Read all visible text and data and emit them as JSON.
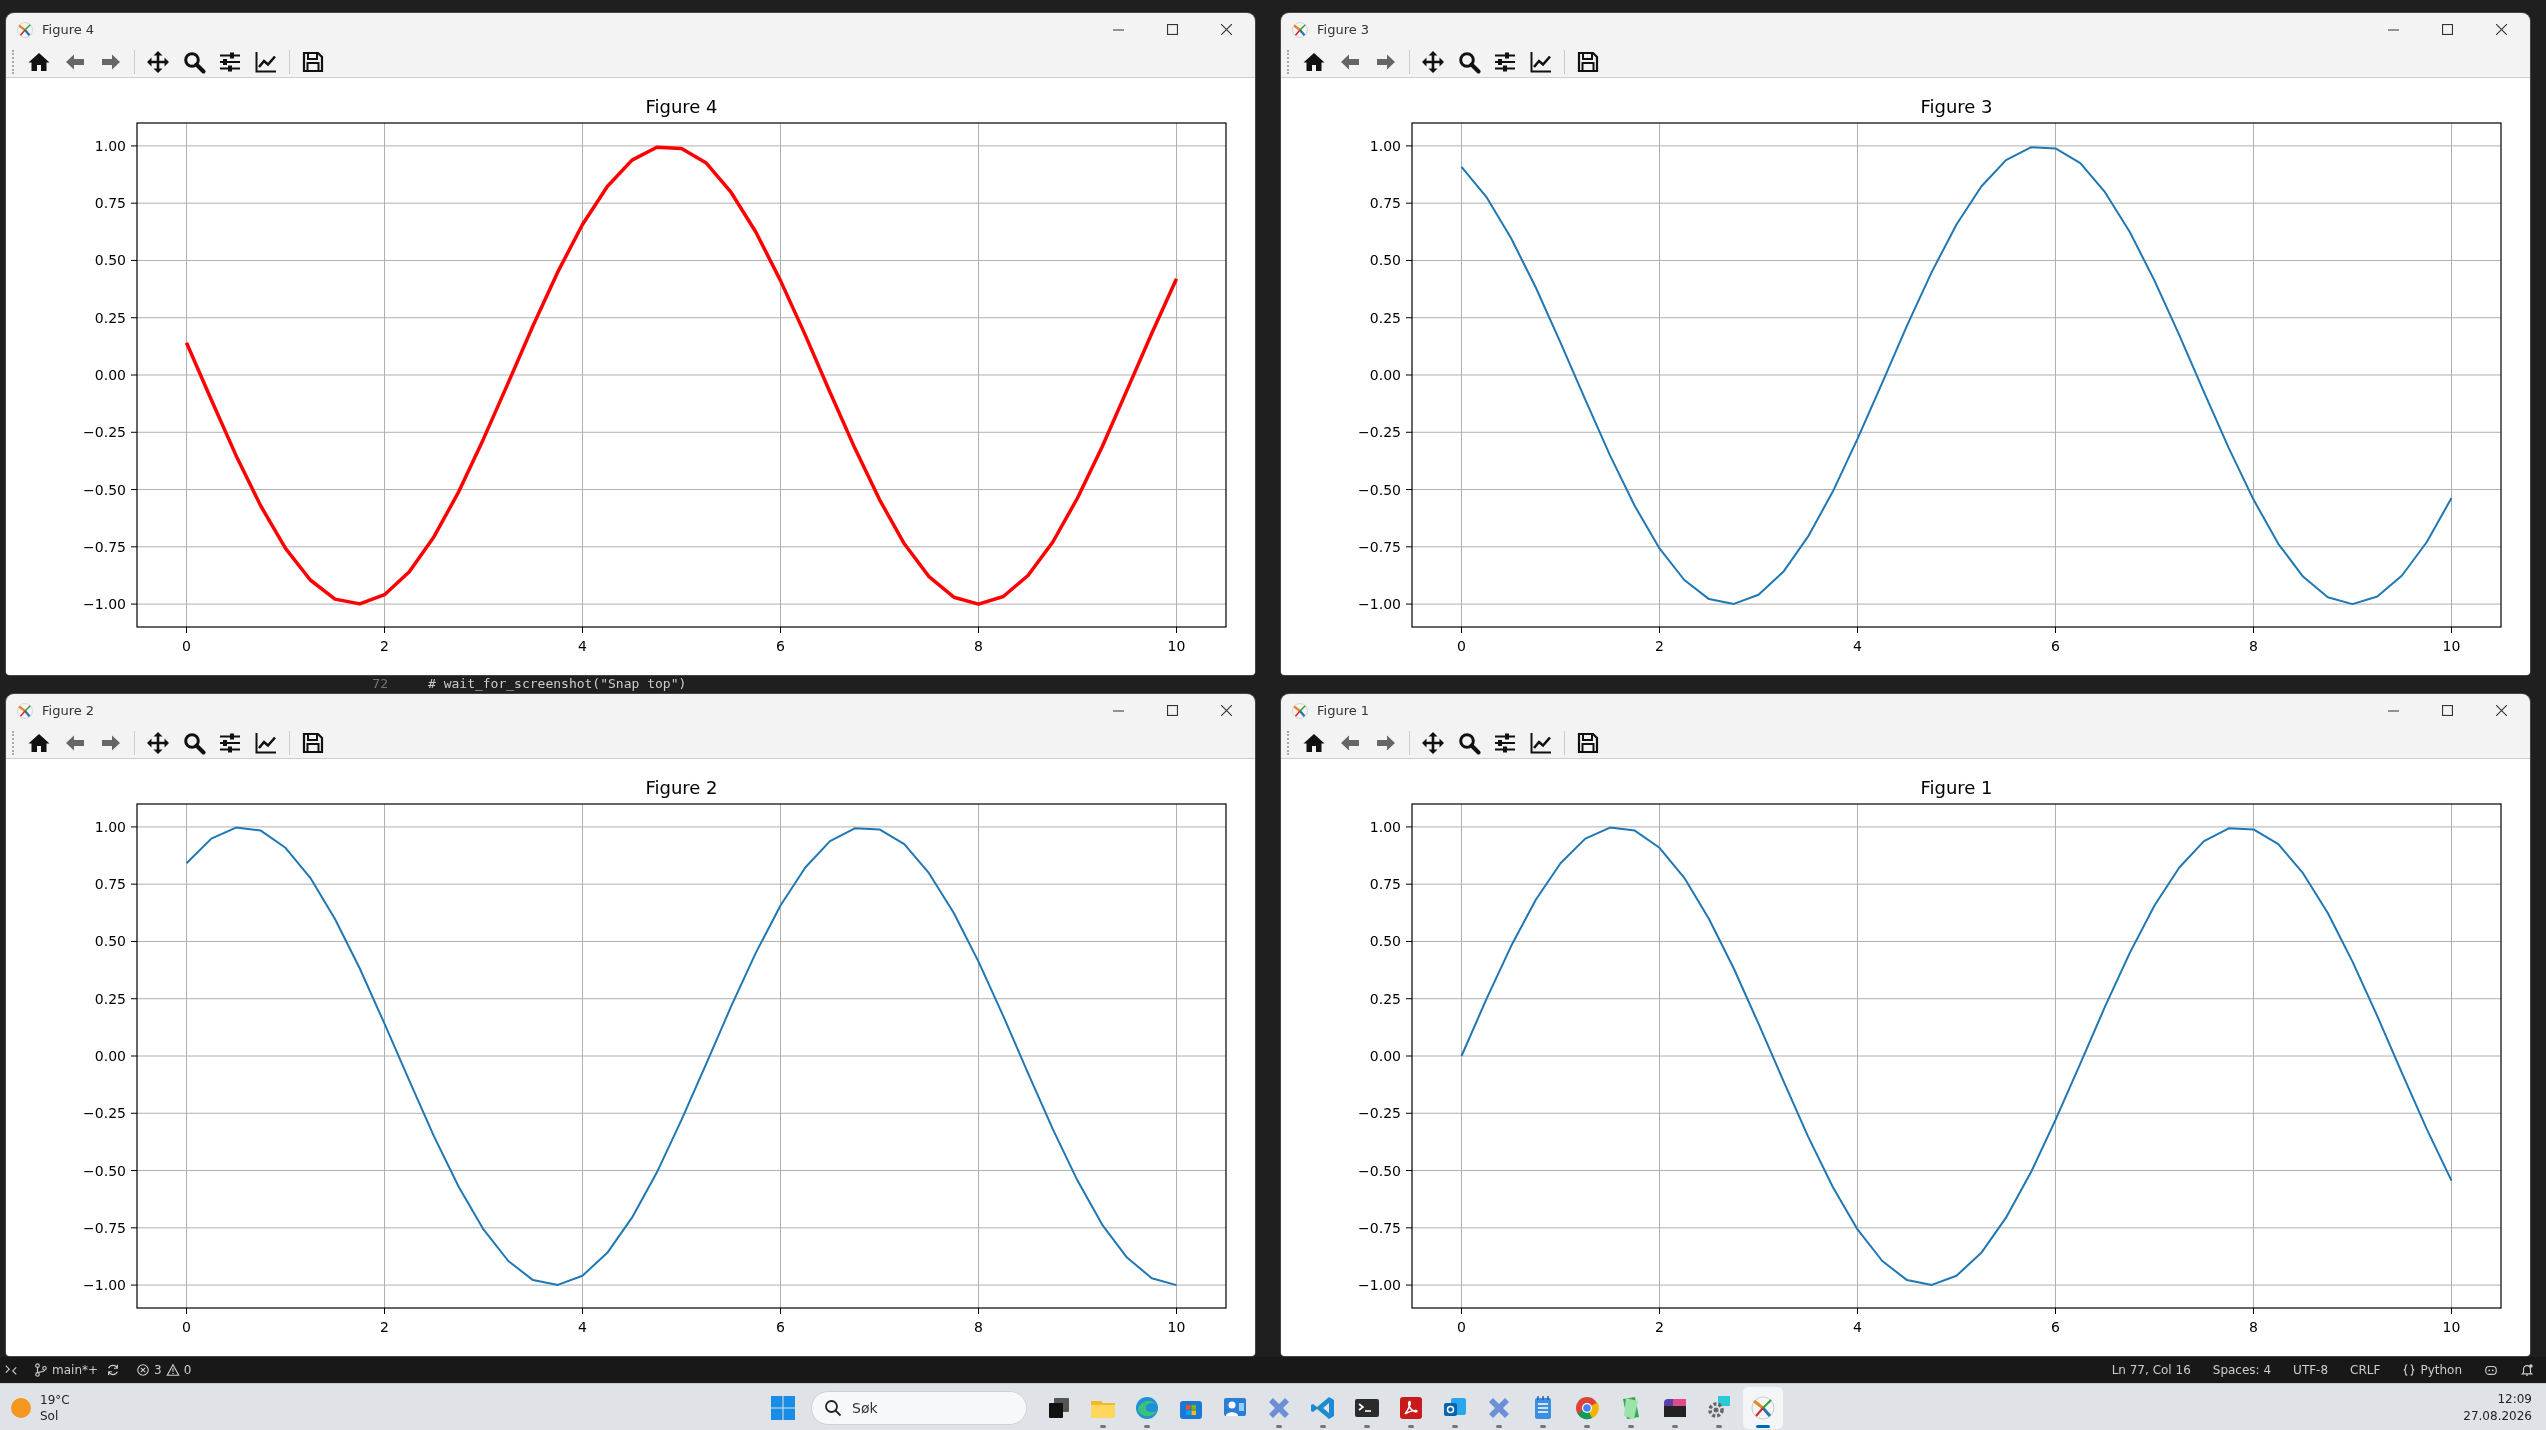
{
  "editor": {
    "line_number": "72",
    "code": "# wait_for_screenshot(\"Snap top\")"
  },
  "windows": [
    {
      "title": "Figure 4",
      "chart_data": {
        "type": "line",
        "title": "Figure 4",
        "grid": true,
        "x": [
          0,
          0.25,
          0.5,
          0.75,
          1,
          1.25,
          1.5,
          1.75,
          2,
          2.25,
          2.5,
          2.75,
          3,
          3.25,
          3.5,
          3.75,
          4,
          4.25,
          4.5,
          4.75,
          5,
          5.25,
          5.5,
          5.75,
          6,
          6.25,
          6.5,
          6.75,
          7,
          7.25,
          7.5,
          7.75,
          8,
          8.25,
          8.5,
          8.75,
          9,
          9.25,
          9.5,
          9.75,
          10
        ],
        "series": [
          {
            "color": "#ff0000",
            "values": [
              0.141,
              -0.108,
              -0.351,
              -0.572,
              -0.757,
              -0.895,
              -0.978,
              -0.999,
              -0.959,
              -0.859,
              -0.706,
              -0.509,
              -0.279,
              -0.033,
              0.215,
              0.45,
              0.657,
              0.823,
              0.938,
              0.994,
              0.989,
              0.925,
              0.798,
              0.624,
              0.412,
              0.174,
              -0.075,
              -0.319,
              -0.544,
              -0.737,
              -0.88,
              -0.97,
              -1,
              -0.967,
              -0.875,
              -0.729,
              -0.537,
              -0.312,
              -0.066,
              0.182,
              0.42
            ]
          }
        ],
        "xlim": [
          -0.5,
          10.5
        ],
        "ylim": [
          -1.1,
          1.1
        ],
        "xticks": [
          0,
          2,
          4,
          6,
          8,
          10
        ],
        "yticks": [
          {
            "value": -1,
            "label": "−1.00"
          },
          {
            "value": -0.75,
            "label": "−0.75"
          },
          {
            "value": -0.5,
            "label": "−0.50"
          },
          {
            "value": -0.25,
            "label": "−0.25"
          },
          {
            "value": 0,
            "label": "0.00"
          },
          {
            "value": 0.25,
            "label": "0.25"
          },
          {
            "value": 0.5,
            "label": "0.50"
          },
          {
            "value": 0.75,
            "label": "0.75"
          },
          {
            "value": 1,
            "label": "1.00"
          }
        ]
      }
    },
    {
      "title": "Figure 3",
      "chart_data": {
        "type": "line",
        "title": "Figure 3",
        "grid": true,
        "x": [
          0,
          0.25,
          0.5,
          0.75,
          1,
          1.25,
          1.5,
          1.75,
          2,
          2.25,
          2.5,
          2.75,
          3,
          3.25,
          3.5,
          3.75,
          4,
          4.25,
          4.5,
          4.75,
          5,
          5.25,
          5.5,
          5.75,
          6,
          6.25,
          6.5,
          6.75,
          7,
          7.25,
          7.5,
          7.75,
          8,
          8.25,
          8.5,
          8.75,
          9,
          9.25,
          9.5,
          9.75,
          10
        ],
        "series": [
          {
            "color": "#1f77b4",
            "values": [
              0.909,
              0.778,
              0.598,
              0.382,
              0.141,
              -0.108,
              -0.351,
              -0.572,
              -0.757,
              -0.895,
              -0.978,
              -0.999,
              -0.959,
              -0.859,
              -0.706,
              -0.509,
              -0.279,
              -0.033,
              0.215,
              0.45,
              0.657,
              0.823,
              0.938,
              0.994,
              0.989,
              0.925,
              0.798,
              0.624,
              0.412,
              0.174,
              -0.075,
              -0.319,
              -0.544,
              -0.737,
              -0.88,
              -0.97,
              -1,
              -0.967,
              -0.875,
              -0.729,
              -0.537
            ]
          }
        ],
        "xlim": [
          -0.5,
          10.5
        ],
        "ylim": [
          -1.1,
          1.1
        ],
        "xticks": [
          0,
          2,
          4,
          6,
          8,
          10
        ],
        "yticks": [
          {
            "value": -1,
            "label": "−1.00"
          },
          {
            "value": -0.75,
            "label": "−0.75"
          },
          {
            "value": -0.5,
            "label": "−0.50"
          },
          {
            "value": -0.25,
            "label": "−0.25"
          },
          {
            "value": 0,
            "label": "0.00"
          },
          {
            "value": 0.25,
            "label": "0.25"
          },
          {
            "value": 0.5,
            "label": "0.50"
          },
          {
            "value": 0.75,
            "label": "0.75"
          },
          {
            "value": 1,
            "label": "1.00"
          }
        ]
      }
    },
    {
      "title": "Figure 2",
      "chart_data": {
        "type": "line",
        "title": "Figure 2",
        "grid": true,
        "x": [
          0,
          0.25,
          0.5,
          0.75,
          1,
          1.25,
          1.5,
          1.75,
          2,
          2.25,
          2.5,
          2.75,
          3,
          3.25,
          3.5,
          3.75,
          4,
          4.25,
          4.5,
          4.75,
          5,
          5.25,
          5.5,
          5.75,
          6,
          6.25,
          6.5,
          6.75,
          7,
          7.25,
          7.5,
          7.75,
          8,
          8.25,
          8.5,
          8.75,
          9,
          9.25,
          9.5,
          9.75,
          10
        ],
        "series": [
          {
            "color": "#1f77b4",
            "values": [
              0.841,
              0.949,
              0.997,
              0.984,
              0.909,
              0.778,
              0.598,
              0.382,
              0.141,
              -0.108,
              -0.351,
              -0.572,
              -0.757,
              -0.895,
              -0.978,
              -0.999,
              -0.959,
              -0.859,
              -0.706,
              -0.509,
              -0.279,
              -0.033,
              0.215,
              0.45,
              0.657,
              0.823,
              0.938,
              0.994,
              0.989,
              0.925,
              0.798,
              0.624,
              0.412,
              0.174,
              -0.075,
              -0.319,
              -0.544,
              -0.737,
              -0.88,
              -0.97,
              -1
            ]
          }
        ],
        "xlim": [
          -0.5,
          10.5
        ],
        "ylim": [
          -1.1,
          1.1
        ],
        "xticks": [
          0,
          2,
          4,
          6,
          8,
          10
        ],
        "yticks": [
          {
            "value": -1,
            "label": "−1.00"
          },
          {
            "value": -0.75,
            "label": "−0.75"
          },
          {
            "value": -0.5,
            "label": "−0.50"
          },
          {
            "value": -0.25,
            "label": "−0.25"
          },
          {
            "value": 0,
            "label": "0.00"
          },
          {
            "value": 0.25,
            "label": "0.25"
          },
          {
            "value": 0.5,
            "label": "0.50"
          },
          {
            "value": 0.75,
            "label": "0.75"
          },
          {
            "value": 1,
            "label": "1.00"
          }
        ]
      }
    },
    {
      "title": "Figure 1",
      "chart_data": {
        "type": "line",
        "title": "Figure 1",
        "grid": true,
        "x": [
          0,
          0.25,
          0.5,
          0.75,
          1,
          1.25,
          1.5,
          1.75,
          2,
          2.25,
          2.5,
          2.75,
          3,
          3.25,
          3.5,
          3.75,
          4,
          4.25,
          4.5,
          4.75,
          5,
          5.25,
          5.5,
          5.75,
          6,
          6.25,
          6.5,
          6.75,
          7,
          7.25,
          7.5,
          7.75,
          8,
          8.25,
          8.5,
          8.75,
          9,
          9.25,
          9.5,
          9.75,
          10
        ],
        "series": [
          {
            "color": "#1f77b4",
            "values": [
              0,
              0.247,
              0.479,
              0.682,
              0.841,
              0.949,
              0.997,
              0.984,
              0.909,
              0.778,
              0.598,
              0.382,
              0.141,
              -0.108,
              -0.351,
              -0.572,
              -0.757,
              -0.895,
              -0.978,
              -0.999,
              -0.959,
              -0.859,
              -0.706,
              -0.509,
              -0.279,
              -0.033,
              0.215,
              0.45,
              0.657,
              0.823,
              0.938,
              0.994,
              0.989,
              0.925,
              0.798,
              0.624,
              0.412,
              0.174,
              -0.075,
              -0.319,
              -0.544
            ]
          }
        ],
        "xlim": [
          -0.5,
          10.5
        ],
        "ylim": [
          -1.1,
          1.1
        ],
        "xticks": [
          0,
          2,
          4,
          6,
          8,
          10
        ],
        "yticks": [
          {
            "value": -1,
            "label": "−1.00"
          },
          {
            "value": -0.75,
            "label": "−0.75"
          },
          {
            "value": -0.5,
            "label": "−0.50"
          },
          {
            "value": -0.25,
            "label": "−0.25"
          },
          {
            "value": 0,
            "label": "0.00"
          },
          {
            "value": 0.25,
            "label": "0.25"
          },
          {
            "value": 0.5,
            "label": "0.50"
          },
          {
            "value": 0.75,
            "label": "0.75"
          },
          {
            "value": 1,
            "label": "1.00"
          }
        ]
      }
    }
  ],
  "status_bar": {
    "branch": "main*+",
    "errors": "3",
    "warnings": "0",
    "position": "Ln 77, Col 16",
    "indentation": "Spaces: 4",
    "encoding": "UTF-8",
    "line_ending": "CRLF",
    "language": "Python"
  },
  "taskbar": {
    "weather": {
      "temperature": "19°C",
      "condition": "Sol"
    },
    "search": {
      "placeholder": "Søk"
    },
    "apps": [
      {
        "running": false,
        "active": false
      },
      {
        "running": true,
        "active": false
      },
      {
        "running": true,
        "active": false
      },
      {
        "running": false,
        "active": false
      },
      {
        "running": false,
        "active": false
      },
      {
        "running": true,
        "active": false
      },
      {
        "running": true,
        "active": false
      },
      {
        "running": true,
        "active": false
      },
      {
        "running": true,
        "active": false
      },
      {
        "running": true,
        "active": false
      },
      {
        "running": true,
        "active": false
      },
      {
        "running": true,
        "active": false
      },
      {
        "running": true,
        "active": false
      },
      {
        "running": true,
        "active": false
      },
      {
        "running": true,
        "active": false
      },
      {
        "running": true,
        "active": false
      },
      {
        "running": true,
        "active": true
      }
    ],
    "clock": {
      "time": "12:09",
      "date": "27.08.2026"
    }
  }
}
